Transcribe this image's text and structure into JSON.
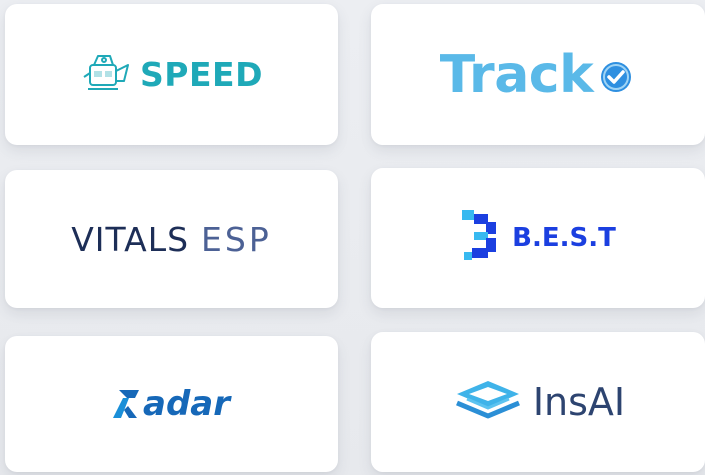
{
  "logos": {
    "speed": {
      "text": "SPEED",
      "icon": "robot-mascot-icon",
      "color": "#1fa9b8"
    },
    "tracko": {
      "text": "Track",
      "icon": "check-circle-icon",
      "color": "#5ab9e8"
    },
    "vitals": {
      "text": "VITALS",
      "accent": "ESP",
      "color": "#1d2e57"
    },
    "best": {
      "text": "B.E.S.T",
      "icon": "pixel-b-icon",
      "color": "#1b3fe0"
    },
    "radar": {
      "text": "adar",
      "icon": "radar-r-icon",
      "color": "#1668b8"
    },
    "insai": {
      "text": "InsAI",
      "icon": "layers-icon",
      "color": "#2d4470"
    }
  }
}
